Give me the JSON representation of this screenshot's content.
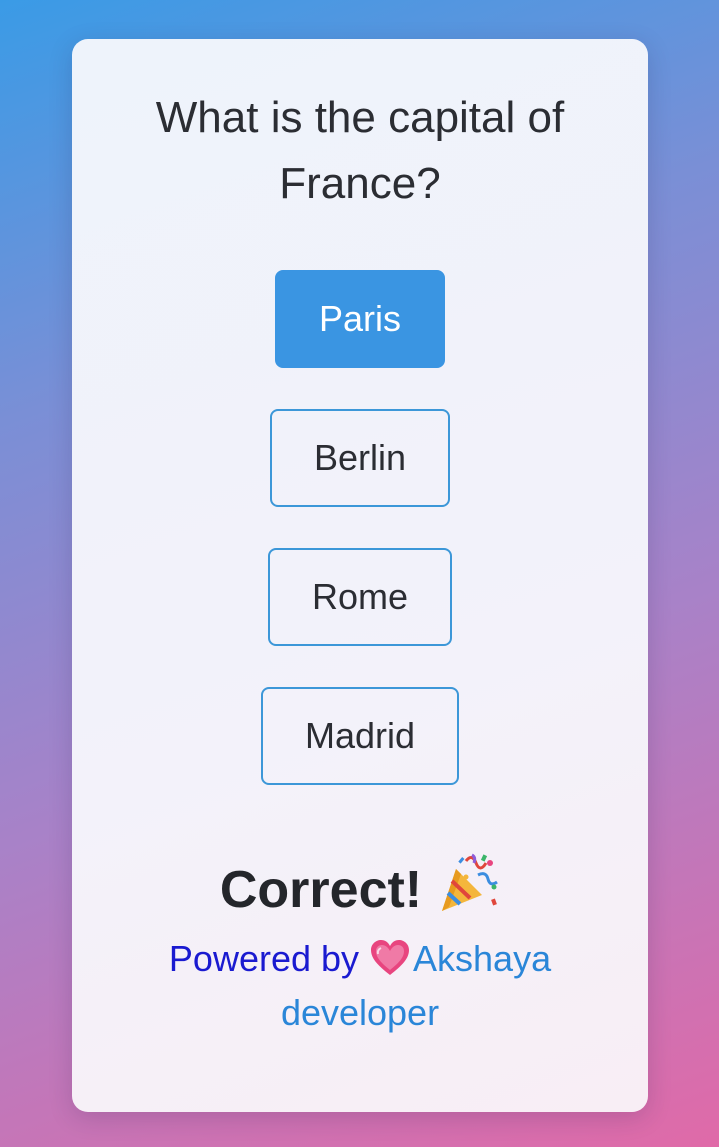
{
  "quiz": {
    "question": "What is the capital of France?",
    "answers": [
      {
        "label": "Paris",
        "selected": true
      },
      {
        "label": "Berlin",
        "selected": false
      },
      {
        "label": "Rome",
        "selected": false
      },
      {
        "label": "Madrid",
        "selected": false
      }
    ],
    "result": "Correct!",
    "result_icon": "party-popper-icon"
  },
  "footer": {
    "powered_by": "Powered by",
    "heart_icon": "heart-icon",
    "developer_link": "Akshaya developer"
  },
  "colors": {
    "accent": "#3a95e2",
    "powered_text": "#1a1ad0",
    "link": "#2a86d8",
    "heart": "#e8457f"
  }
}
